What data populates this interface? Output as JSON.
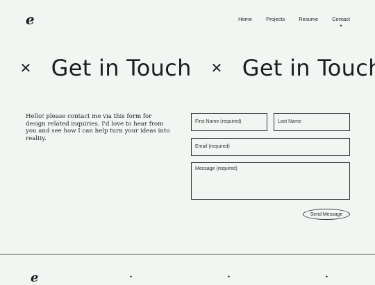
{
  "brand": {
    "logo": "e"
  },
  "nav": {
    "items": [
      {
        "label": "Home"
      },
      {
        "label": "Projects"
      },
      {
        "label": "Resume"
      },
      {
        "label": "Contact",
        "active": true
      }
    ],
    "active_marker": "✦"
  },
  "marquee": {
    "text": "Get in Touch",
    "separator": "✕"
  },
  "intro": {
    "text": "Hello! please contact me via this form for design related inquiries. I'd love to hear from you and see how I can help turn your ideas into reality."
  },
  "form": {
    "first_name_placeholder": "First Name (required)",
    "last_name_placeholder": "Last Name",
    "email_placeholder": "Email (required)",
    "message_placeholder": "Message (required)",
    "submit_label": "Send Message"
  },
  "footer": {
    "logo": "e",
    "star": "✦"
  },
  "colors": {
    "background": "#f2f6f3",
    "text": "#1d1d1d",
    "border": "#333333"
  }
}
